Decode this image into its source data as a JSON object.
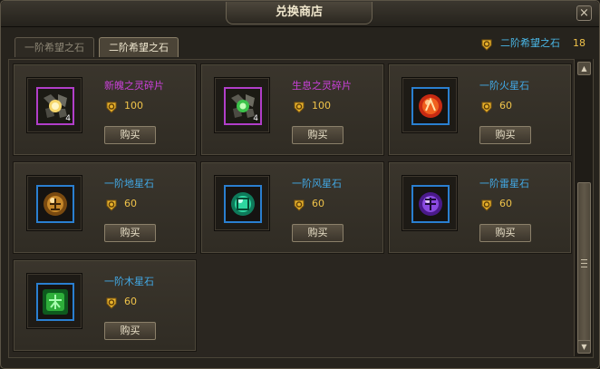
{
  "window": {
    "title": "兑换商店",
    "close_icon": "×"
  },
  "tabs": [
    {
      "label": "一阶希望之石",
      "active": false
    },
    {
      "label": "二阶希望之石",
      "active": true
    }
  ],
  "currency": {
    "icon": "coin-icon",
    "label": "二阶希望之石",
    "count": "18"
  },
  "colors": {
    "price_gold": "#f0c34a",
    "name_blue": "#42a9e6",
    "name_purple": "#c941d8",
    "frame_blue": "#2a7fd0",
    "frame_purple": "#b13ec9"
  },
  "items": [
    {
      "name": "新魄之灵碎片",
      "price": "100",
      "buy_label": "购买",
      "stack": "4",
      "rarity": "purple",
      "icon": "gold-fragment-icon"
    },
    {
      "name": "生息之灵碎片",
      "price": "100",
      "buy_label": "购买",
      "stack": "4",
      "rarity": "purple",
      "icon": "green-fragment-icon"
    },
    {
      "name": "一阶火星石",
      "price": "60",
      "buy_label": "购买",
      "stack": "",
      "rarity": "blue",
      "icon": "fire-gem-icon"
    },
    {
      "name": "一阶地星石",
      "price": "60",
      "buy_label": "购买",
      "stack": "",
      "rarity": "blue",
      "icon": "earth-gem-icon"
    },
    {
      "name": "一阶风星石",
      "price": "60",
      "buy_label": "购买",
      "stack": "",
      "rarity": "blue",
      "icon": "wind-gem-icon"
    },
    {
      "name": "一阶雷星石",
      "price": "60",
      "buy_label": "购买",
      "stack": "",
      "rarity": "blue",
      "icon": "thunder-gem-icon"
    },
    {
      "name": "一阶木星石",
      "price": "60",
      "buy_label": "购买",
      "stack": "",
      "rarity": "blue",
      "icon": "wood-gem-icon"
    }
  ],
  "scrollbar": {
    "up_icon": "▲",
    "down_icon": "▼"
  }
}
